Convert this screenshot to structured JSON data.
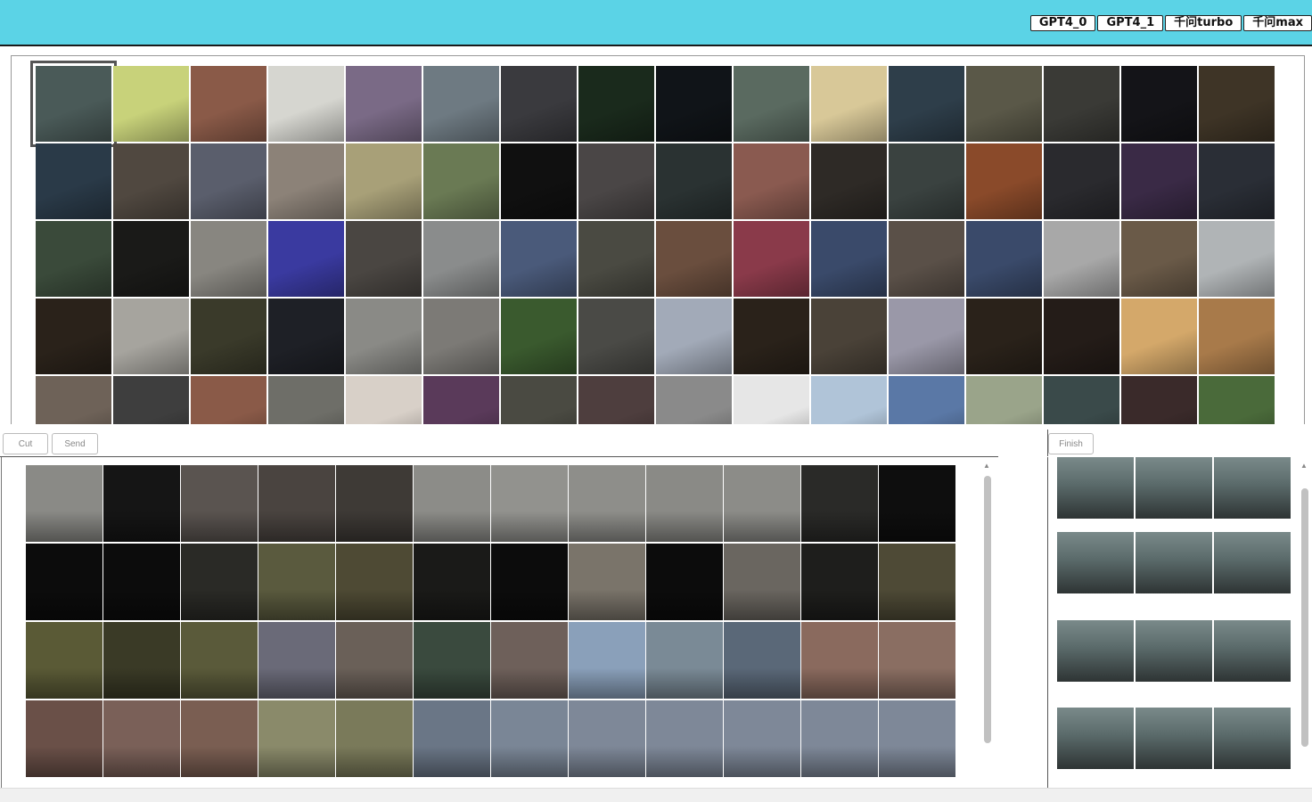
{
  "header": {
    "model_buttons": [
      {
        "label": "GPT4_0"
      },
      {
        "label": "GPT4_1"
      },
      {
        "label": "千问turbo"
      },
      {
        "label": "千问max"
      }
    ],
    "background": "#5bd3e6"
  },
  "toolbar": {
    "cut_label": "Cut",
    "send_label": "Send",
    "finish_label": "Finish"
  },
  "gallery": {
    "selected_index": 0,
    "thumb_colors": [
      "#4a5a58",
      "#c8d27a",
      "#8a5a48",
      "#d6d6d0",
      "#7a6a86",
      "#6e7a82",
      "#3a3a3e",
      "#1a2a1c",
      "#101418",
      "#5a6a60",
      "#d8c898",
      "#2e3e4a",
      "#5a5848",
      "#3a3a36",
      "#141418",
      "#3e3426",
      "#2a3a48",
      "#504840",
      "#5a5e6c",
      "#8c8278",
      "#a8a078",
      "#6a7a54",
      "#101010",
      "#4a4646",
      "#2a3232",
      "#8a5a50",
      "#2e2a26",
      "#3a4240",
      "#8a4a2a",
      "#2a2a2e",
      "#3a2a46",
      "#2a2e36",
      "#3a4a3a",
      "#1a1a18",
      "#888680",
      "#3a3aa0",
      "#4a4642",
      "#8a8c8c",
      "#4a5a7a",
      "#4a4a42",
      "#6a4e3e",
      "#8a3a4a",
      "#3a4a6a",
      "#5a5048",
      "#3a4a6a",
      "#a8a8a8",
      "#6a5a48",
      "#b0b4b6",
      "#2a221a",
      "#a6a49e",
      "#3a3a2a",
      "#1e2026",
      "#8a8a86",
      "#7c7a76",
      "#3a5a2e",
      "#4a4a46",
      "#a2aab8",
      "#2a221a",
      "#4a4238",
      "#9a98a8",
      "#2a221a",
      "#241c18",
      "#d4a86a",
      "#a87a4a",
      "#6e6258",
      "#3e3e3e",
      "#8a5a48",
      "#6e6e68",
      "#d8d0c8",
      "#5a3a5a",
      "#4a4a42",
      "#4e3e3e",
      "#8a8a8a",
      "#e6e6e6",
      "#b0c4d8",
      "#5a78a6",
      "#9aa48a",
      "#3a4a4a",
      "#3a2a2a",
      "#4a6a3a"
    ]
  },
  "frames": {
    "rows": [
      [
        "#8a8a86",
        "#151515",
        "#5a5450",
        "#4a4440",
        "#3e3a36",
        "#8c8c88",
        "#92928e",
        "#8e8e8a",
        "#8a8a86",
        "#8c8c88",
        "#2a2a28",
        "#0e0e0e"
      ],
      [
        "#0c0c0c",
        "#0c0c0c",
        "#2a2a26",
        "#5a5a3e",
        "#4e4a34",
        "#1a1a18",
        "#0c0c0c",
        "#7a746a",
        "#0c0c0c",
        "#6a6660",
        "#1e1e1c",
        "#4e4a36"
      ],
      [
        "#5a5a36",
        "#3a3a26",
        "#5a5a3a",
        "#6a6a78",
        "#6a6058",
        "#3a4a3e",
        "#6e605a",
        "#8aa0ba",
        "#7a8a96",
        "#5a6878",
        "#8a6a5e",
        "#8a6e62"
      ],
      [
        "#6a5048",
        "#7a6058",
        "#7a5e52",
        "#8a8a6a",
        "#7a7a5a",
        "#6a7686",
        "#7a8696",
        "#7e8898",
        "#7e8898",
        "#7e8898",
        "#7e8898",
        "#7e8898"
      ]
    ]
  },
  "selection": {
    "groups": [
      [
        "#5a6a6a",
        "#5a6a6a",
        "#5a6a6a"
      ],
      [
        "#5a6a6a",
        "#5a6a6a",
        "#5a6a6a"
      ],
      [
        "#5a6a6a",
        "#5a6a6a",
        "#5a6a6a"
      ],
      [
        "#5a6a6a",
        "#5a6a6a",
        "#5a6a6a"
      ]
    ]
  }
}
